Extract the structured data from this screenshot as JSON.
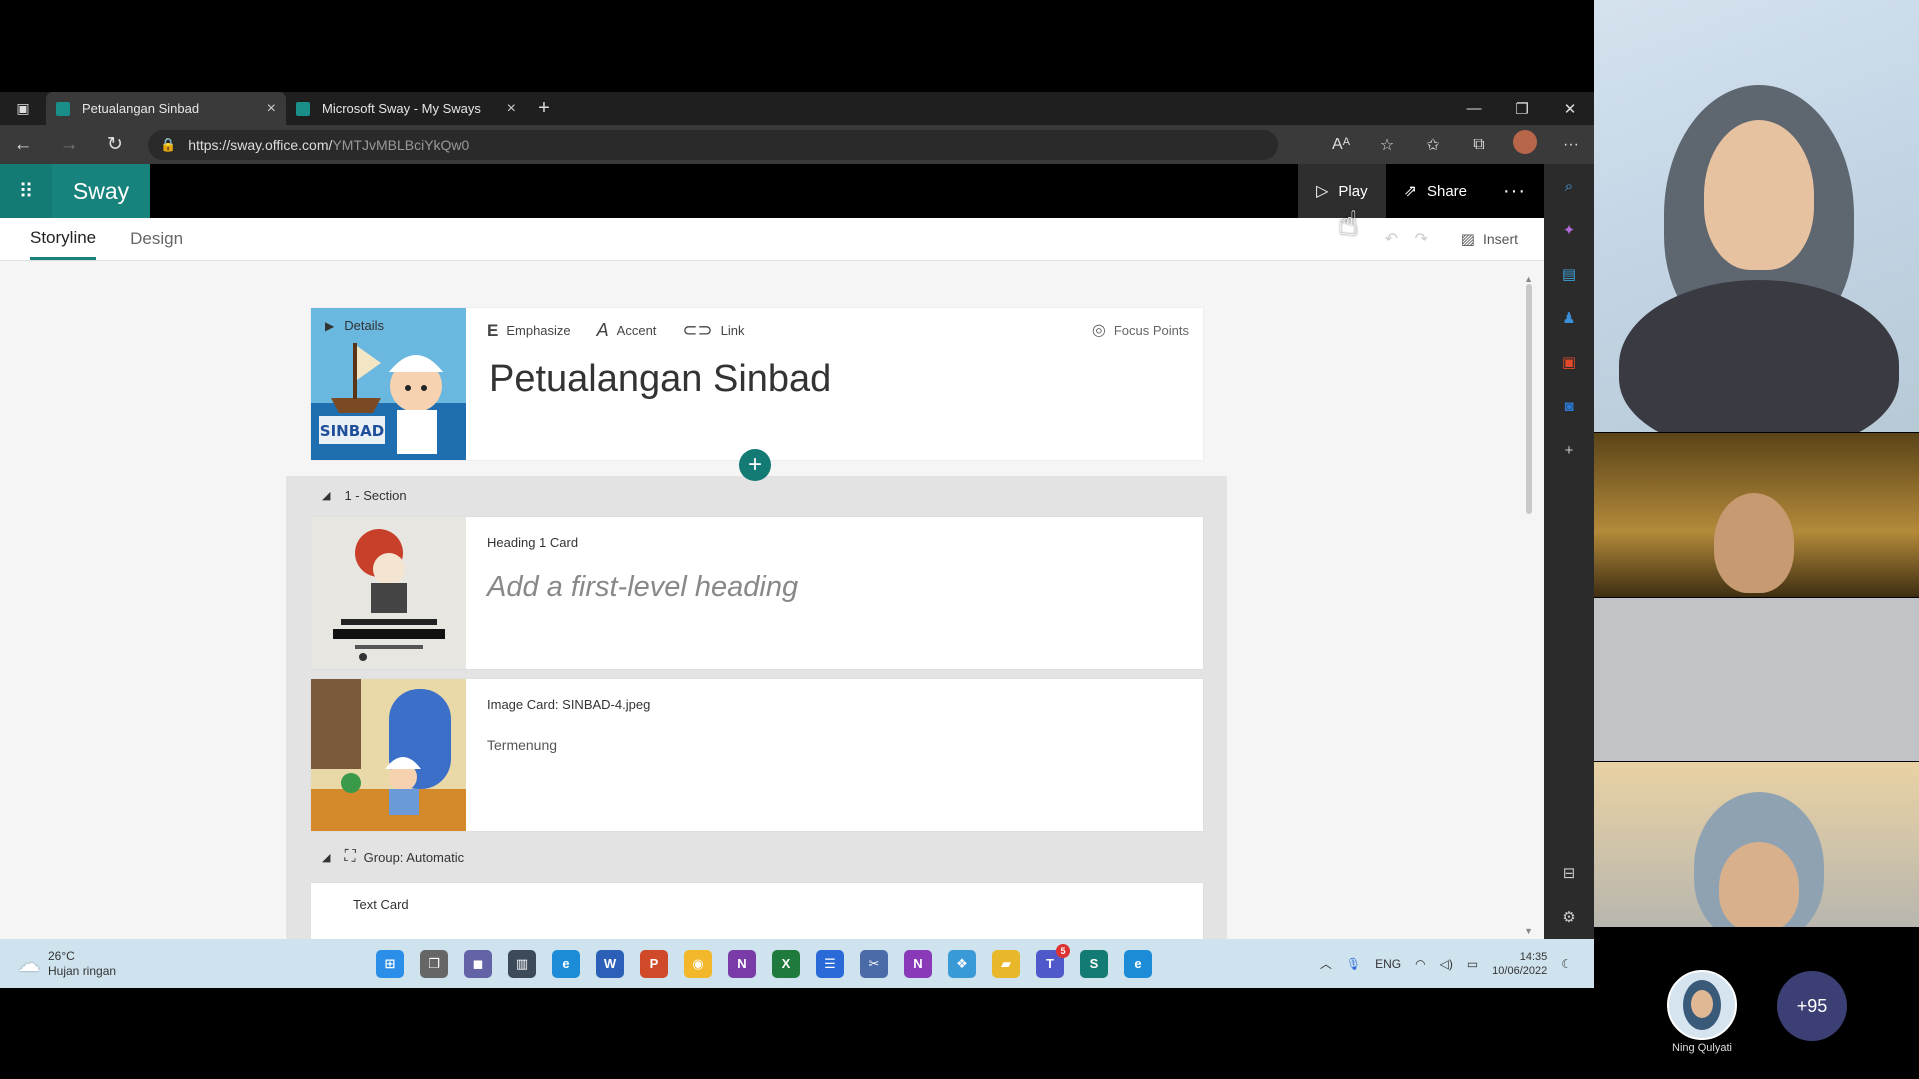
{
  "browser": {
    "tabs": [
      {
        "title": "Petualangan Sinbad",
        "active": true
      },
      {
        "title": "Microsoft Sway - My Sways",
        "active": false
      }
    ],
    "new_tab": "+",
    "url_host": "https://sway.office.com/",
    "url_path": "YMTJvMBLBciYkQw0"
  },
  "sway": {
    "app_name": "Sway",
    "play_label": "Play",
    "share_label": "Share",
    "more_label": "···",
    "subtabs": [
      "Storyline",
      "Design"
    ],
    "insert_label": "Insert"
  },
  "storyline": {
    "title_card": {
      "details_label": "Details",
      "toolbar": [
        "Emphasize",
        "Accent",
        "Link"
      ],
      "focus_points": "Focus Points",
      "title": "Petualangan Sinbad"
    },
    "section_label": "1 - Section",
    "heading_card": {
      "label": "Heading 1 Card",
      "placeholder": "Add a first-level heading"
    },
    "image_card": {
      "label": "Image Card: SINBAD-4.jpeg",
      "caption": "Termenung"
    },
    "group_label": "Group: Automatic",
    "text_card_label": "Text Card"
  },
  "taskbar": {
    "temp": "26°C",
    "weather": "Hujan ringan",
    "lang": "ENG",
    "time": "14:35",
    "date": "10/06/2022",
    "teams_badge": "5"
  },
  "meeting": {
    "participant_name": "Ning Qulyati",
    "more_participants": "+95"
  },
  "colors": {
    "sway_teal": "#137a74",
    "taskbar": "#cfe3ee",
    "meeting_bubble": "#3b3f73"
  }
}
